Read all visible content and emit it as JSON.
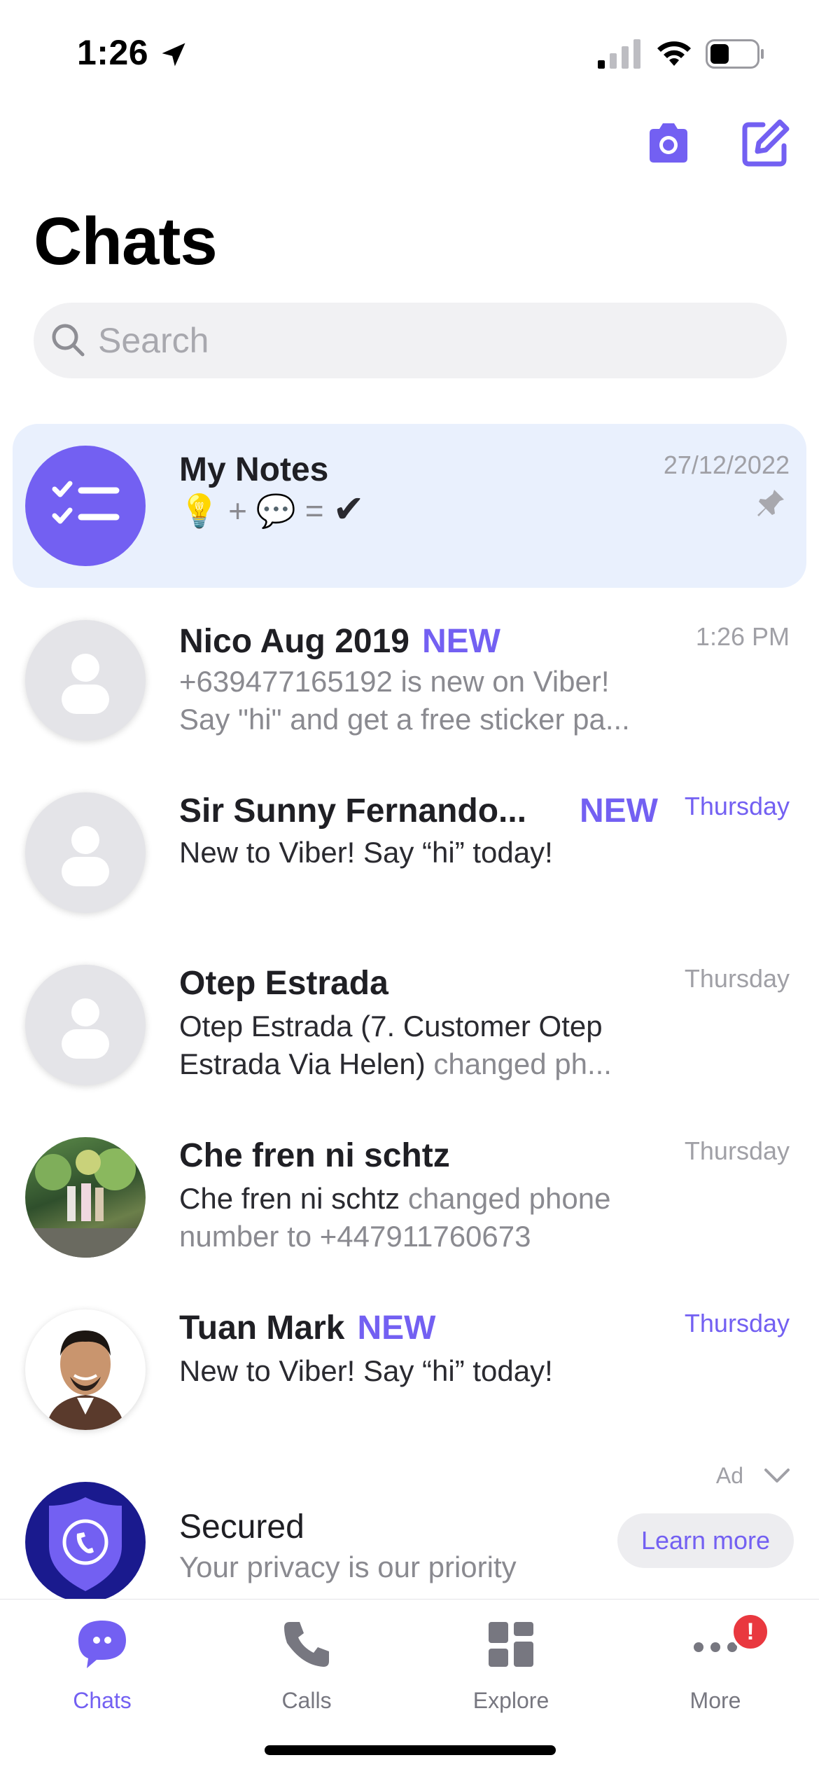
{
  "status_bar": {
    "time": "1:26"
  },
  "header": {
    "title": "Chats"
  },
  "search": {
    "placeholder": "Search"
  },
  "chats": [
    {
      "name": "My Notes",
      "time": "27/12/2022",
      "pinned": true,
      "preview_emoji": [
        "💡",
        "+",
        "💬",
        "=",
        "✔"
      ]
    },
    {
      "name": "Nico Aug 2019",
      "badge": "NEW",
      "time": "1:26 PM",
      "preview_line1": "+639477165192 is new on Viber!",
      "preview_line2": "Say \"hi\" and get a free sticker pa..."
    },
    {
      "name": "Sir Sunny Fernando...",
      "badge": "NEW",
      "time": "Thursday",
      "preview_line1": "New to Viber! Say “hi” today!"
    },
    {
      "name": "Otep Estrada",
      "time": "Thursday",
      "preview_dark": "Otep Estrada (7. Customer Otep Estrada Via Helen)",
      "preview_light": " changed ph..."
    },
    {
      "name": "Che fren ni schtz",
      "time": "Thursday",
      "preview_dark": "Che fren ni schtz",
      "preview_light": " changed phone number to +447911760673"
    },
    {
      "name": "Tuan Mark",
      "badge": "NEW",
      "time": "Thursday",
      "preview_line1": "New to Viber! Say “hi” today!"
    }
  ],
  "ad": {
    "label": "Ad",
    "title": "Secured",
    "subtitle": "Your privacy is our priority",
    "cta": "Learn more"
  },
  "tabs": [
    {
      "label": "Chats",
      "icon": "chat-bubble-icon",
      "active": true
    },
    {
      "label": "Calls",
      "icon": "phone-icon"
    },
    {
      "label": "Explore",
      "icon": "explore-grid-icon"
    },
    {
      "label": "More",
      "icon": "more-dots-icon",
      "badge": "!"
    }
  ],
  "colors": {
    "accent": "#7360f2",
    "pinned_bg": "#e9f0fd",
    "badge_red": "#e9383f"
  }
}
